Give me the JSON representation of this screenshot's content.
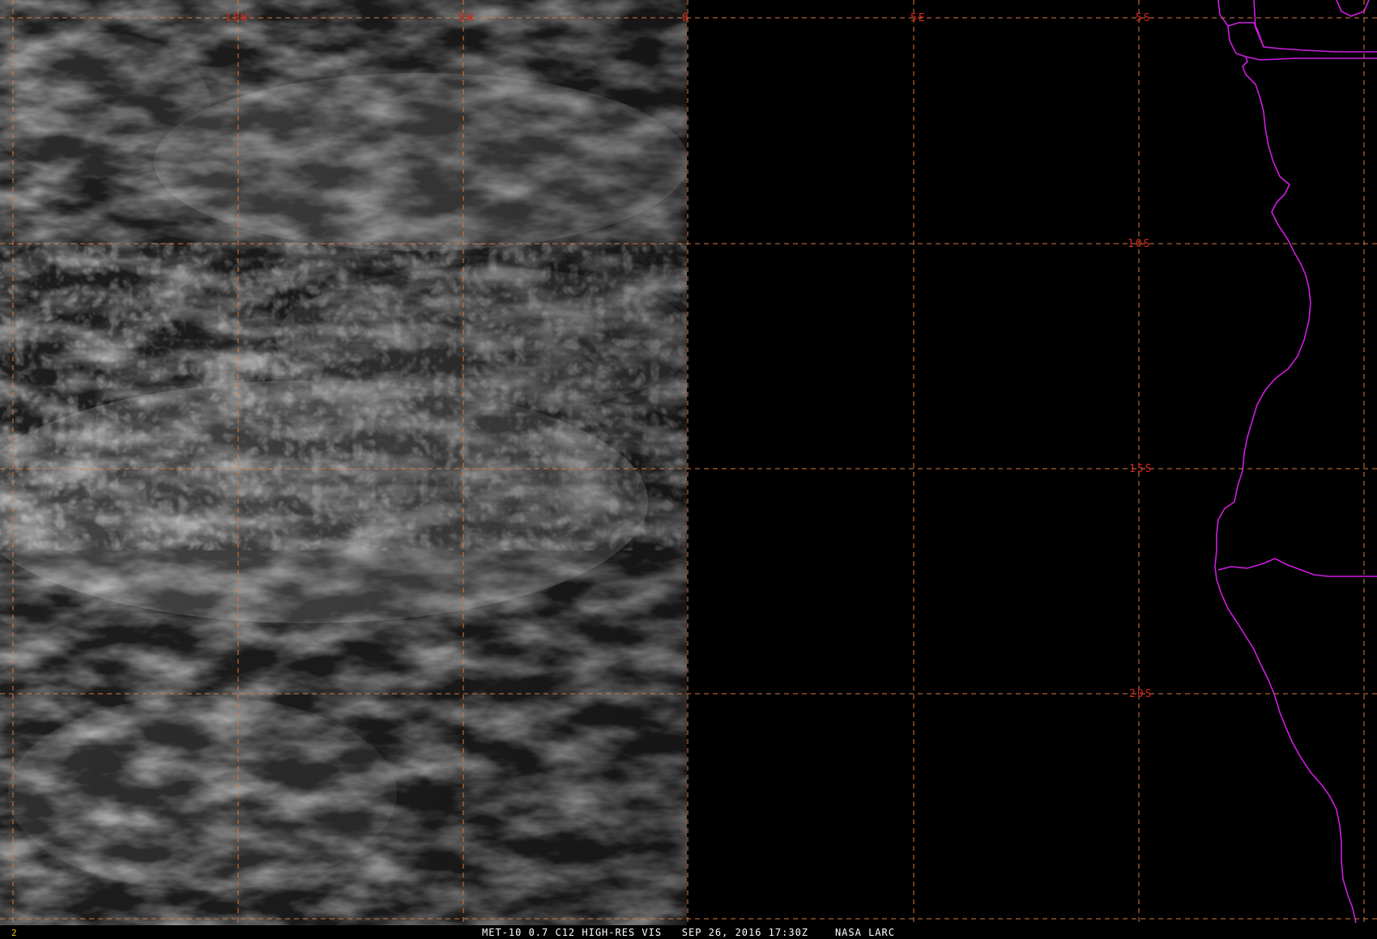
{
  "caption": {
    "product": "MET-10 0.7 C12 HIGH-RES VIS",
    "datetime": "SEP 26, 2016 17:30Z",
    "source": "NASA LARC"
  },
  "frame_number": "2",
  "grid": {
    "longitudes": [
      {
        "label": "10W",
        "value": -10
      },
      {
        "label": "5W",
        "value": -5
      },
      {
        "label": "0",
        "value": 0
      },
      {
        "label": "5E",
        "value": 5
      }
    ],
    "latitudes": [
      {
        "label": "5S",
        "value": -5
      },
      {
        "label": "10S",
        "value": -10
      },
      {
        "label": "15S",
        "value": -15
      },
      {
        "label": "20S",
        "value": -20
      }
    ]
  },
  "colors": {
    "grid": "#d87a3c",
    "grid_label": "#d8281e",
    "coastline": "#d01ce0",
    "background": "#000000",
    "frame_number": "#e6c020"
  },
  "regions": [
    "visible-imagery-west",
    "no-data-east",
    "africa-coastline"
  ]
}
